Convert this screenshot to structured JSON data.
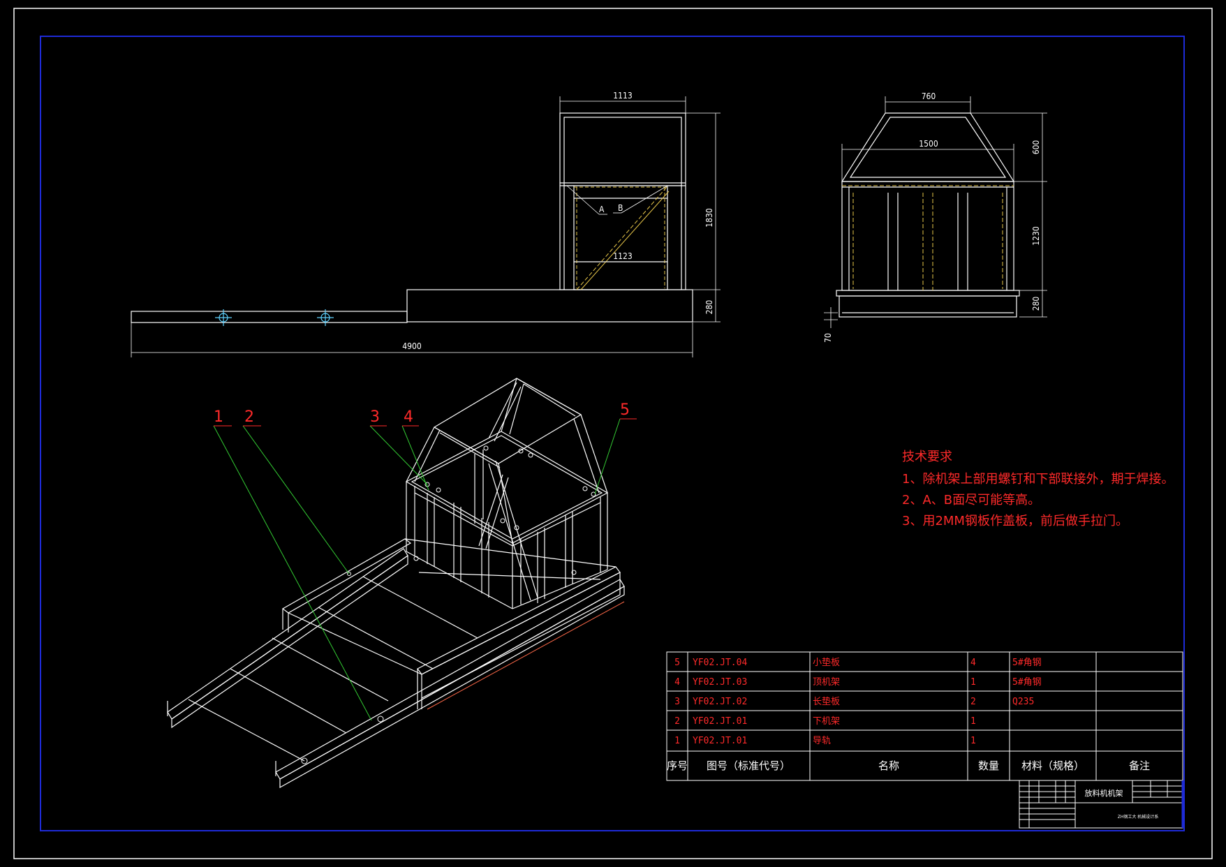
{
  "colors": {
    "background": "#000000",
    "outer_frame": "#ffffff",
    "inner_frame": "#1e2bd8",
    "lines": "#ffffff",
    "text": "#ff2a2a",
    "leader": "#33cc33",
    "hidden": "#e8c74a"
  },
  "dimensions": {
    "front_top_width": "1113",
    "front_inner_width": "1123",
    "front_total_height": "1830",
    "front_base_height": "280",
    "front_total_length": "4900",
    "label_a": "A",
    "label_b": "B",
    "side_top_width": "760",
    "side_width": "1500",
    "side_roof_height": "600",
    "side_body_height": "1230",
    "side_base_height": "280",
    "side_foot_height": "70"
  },
  "callouts": [
    "1",
    "2",
    "3",
    "4",
    "5"
  ],
  "notes": {
    "title": "技术要求",
    "items": [
      "1、除机架上部用螺钉和下部联接外，期于焊接。",
      "2、A、B面尽可能等高。",
      "3、用2MM钢板作盖板，前后做手拉门。"
    ]
  },
  "bom": {
    "rows": [
      {
        "no": "5",
        "code": "YF02.JT.04",
        "name": "小垫板",
        "qty": "4",
        "material": "5#角钢",
        "remark": ""
      },
      {
        "no": "4",
        "code": "YF02.JT.03",
        "name": "顶机架",
        "qty": "1",
        "material": "5#角钢",
        "remark": ""
      },
      {
        "no": "3",
        "code": "YF02.JT.02",
        "name": "长垫板",
        "qty": "2",
        "material": "Q235",
        "remark": ""
      },
      {
        "no": "2",
        "code": "YF02.JT.01",
        "name": "下机架",
        "qty": "1",
        "material": "",
        "remark": ""
      },
      {
        "no": "1",
        "code": "YF02.JT.01",
        "name": "导轨",
        "qty": "1",
        "material": "",
        "remark": ""
      }
    ],
    "header": {
      "no": "序号",
      "code": "图号（标准代号）",
      "name": "名称",
      "qty": "数量",
      "material": "材料（规格）",
      "remark": "备注"
    }
  },
  "title_block": {
    "drawing_name": "放料机机架",
    "company": "ZH钢工大 机械设计系"
  }
}
